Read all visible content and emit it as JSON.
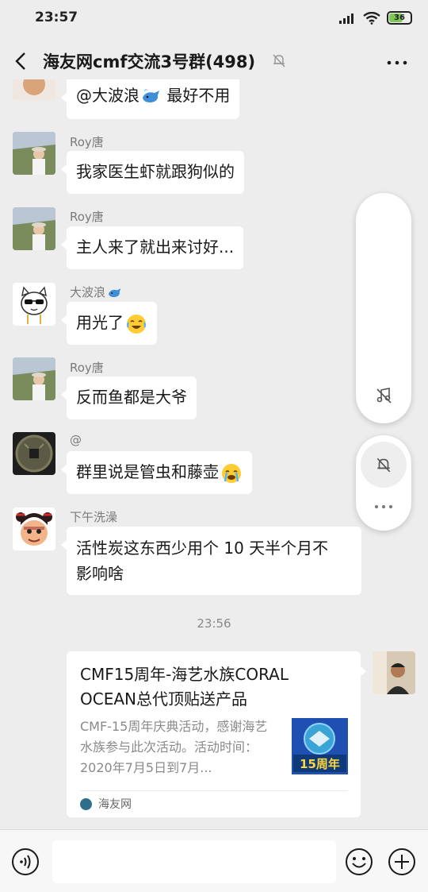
{
  "status_bar": {
    "time": "23:57",
    "battery": "36"
  },
  "header": {
    "title": "海友网cmf交流3号群(498)"
  },
  "messages": [
    {
      "sender": "",
      "text": "@大波浪",
      "text_suffix": " 最好不用"
    },
    {
      "sender": "Roy唐",
      "text": "我家医生虾就跟狗似的"
    },
    {
      "sender": "Roy唐",
      "text": "主人来了就出来讨好..."
    },
    {
      "sender": "大波浪",
      "text": "用光了"
    },
    {
      "sender": "Roy唐",
      "text": "反而鱼都是大爷"
    },
    {
      "sender": "@",
      "text": "群里说是管虫和藤壶"
    },
    {
      "sender": "下午洗澡",
      "text_line1": "活性炭这东西少用个 10 天半个月不",
      "text_line2": "影响啥"
    }
  ],
  "timestamp": "23:56",
  "link_card": {
    "title": "CMF15周年-海艺水族CORAL OCEAN总代顶贴送产品",
    "description": "CMF-15周年庆典活动，感谢海艺水族参与此次活动。活动时间：2020年7月5日到7月...",
    "thumb_label": "15周年",
    "source": "海友网"
  }
}
